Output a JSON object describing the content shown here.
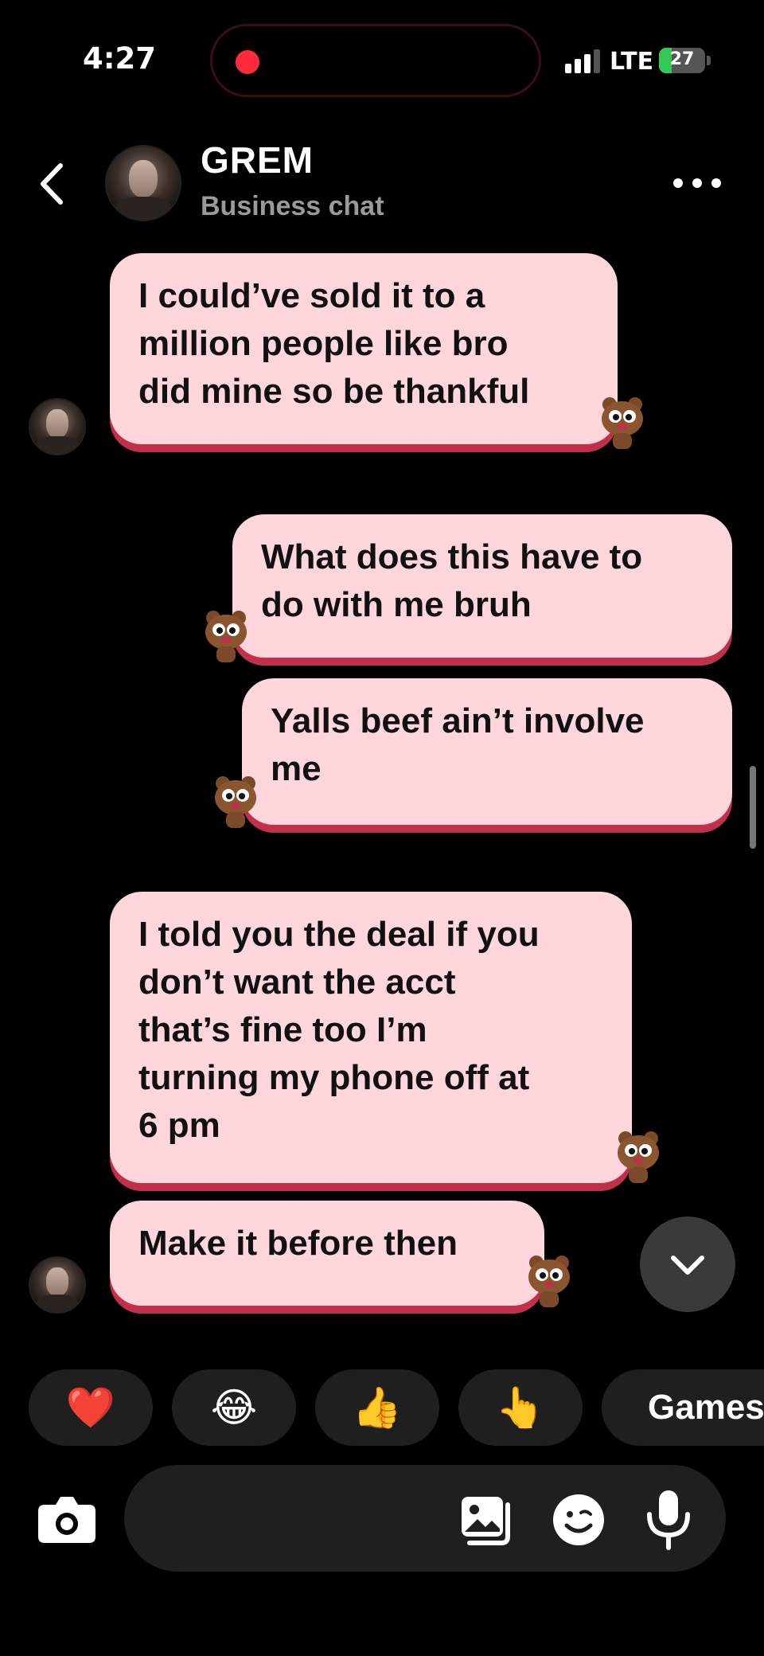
{
  "status_bar": {
    "time": "4:27",
    "network": "LTE",
    "battery_percent": "27",
    "battery_level": 0.27,
    "colors": {
      "record_dot": "#ff2b3b",
      "battery_fill": "#34c759"
    }
  },
  "header": {
    "contact_name": "GREM",
    "subtitle": "Business chat",
    "icons": {
      "back": "chevron-left-icon",
      "more": "more-horizontal-icon"
    }
  },
  "messages": [
    {
      "from": "them",
      "text": "I could’ve sold it to a\nmillion people like bro\ndid mine so be thankful"
    },
    {
      "from": "me",
      "text": "What does this have to\ndo with me bruh"
    },
    {
      "from": "me",
      "text": "Yalls beef ain’t involve\nme"
    },
    {
      "from": "them",
      "text": "I told you the deal if you\ndon’t want the acct\nthat’s fine too I’m\nturning my phone off at\n6 pm"
    },
    {
      "from": "them",
      "text": "Make it before then"
    }
  ],
  "bubble_colors": {
    "fill": "#ffd6dc",
    "edge": "#c0304a",
    "text": "#111111"
  },
  "quick_reactions": [
    {
      "emoji": "❤️",
      "name": "heart"
    },
    {
      "emoji": "😂",
      "name": "laughing"
    },
    {
      "emoji": "👍",
      "name": "thumbs-up"
    },
    {
      "emoji": "👆",
      "name": "pointing"
    }
  ],
  "games": {
    "label": "Games",
    "icon": "gamepad-icon",
    "color": "#5b4cf5"
  },
  "composer": {
    "placeholder": "",
    "icons": [
      "camera-icon",
      "gallery-icon",
      "sticker-icon",
      "microphone-icon"
    ]
  },
  "scroll_down_icon": "chevron-down-icon"
}
